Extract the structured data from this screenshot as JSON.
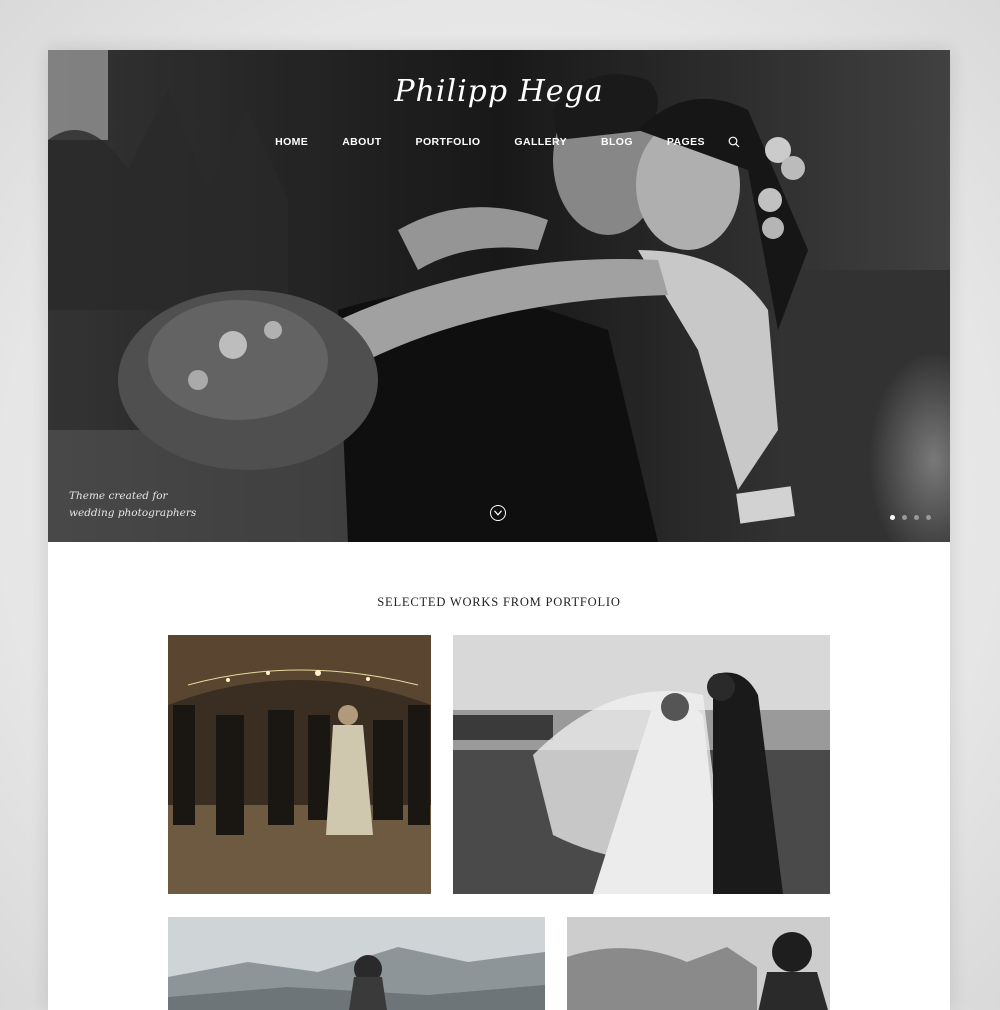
{
  "hero": {
    "logo": "Philipp Hega",
    "nav": [
      "HOME",
      "ABOUT",
      "PORTFOLIO",
      "GALLERY",
      "BLOG",
      "PAGES"
    ],
    "tagline_line1": "Theme created for",
    "tagline_line2": "wedding photographers",
    "slider_dots": 4,
    "active_dot": 1
  },
  "portfolio": {
    "title": "SELECTED WORKS FROM PORTFOLIO"
  },
  "icons": {
    "search": "search-icon",
    "scroll": "chevron-down-icon"
  }
}
